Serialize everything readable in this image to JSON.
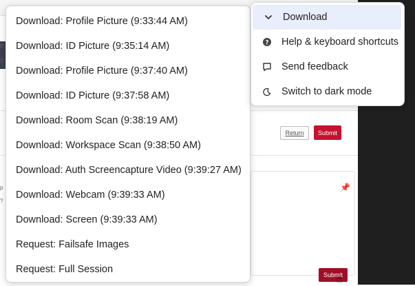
{
  "left_menu": {
    "items": [
      "Download: Profile Picture (9:33:44 AM)",
      "Download: ID Picture (9:35:14 AM)",
      "Download: Profile Picture (9:37:40 AM)",
      "Download: ID Picture (9:37:58 AM)",
      "Download: Room Scan (9:38:19 AM)",
      "Download: Workspace Scan (9:38:50 AM)",
      "Download: Auth Screencapture Video (9:39:27 AM)",
      "Download: Webcam (9:39:33 AM)",
      "Download: Screen (9:39:33 AM)",
      "Request: Failsafe Images",
      "Request: Full Session"
    ]
  },
  "right_menu": {
    "items": [
      {
        "label": "Download",
        "icon": "chevron-down-icon"
      },
      {
        "label": "Help & keyboard shortcuts",
        "icon": "help-icon"
      },
      {
        "label": "Send feedback",
        "icon": "feedback-icon"
      },
      {
        "label": "Switch to dark mode",
        "icon": "moon-icon"
      }
    ]
  },
  "background": {
    "return_label": "Return",
    "submit_label": "Submit",
    "submit_label_2": "Submit",
    "side_p": "p",
    "side_q": "?",
    "side_8": "8",
    "side_s": "S"
  }
}
